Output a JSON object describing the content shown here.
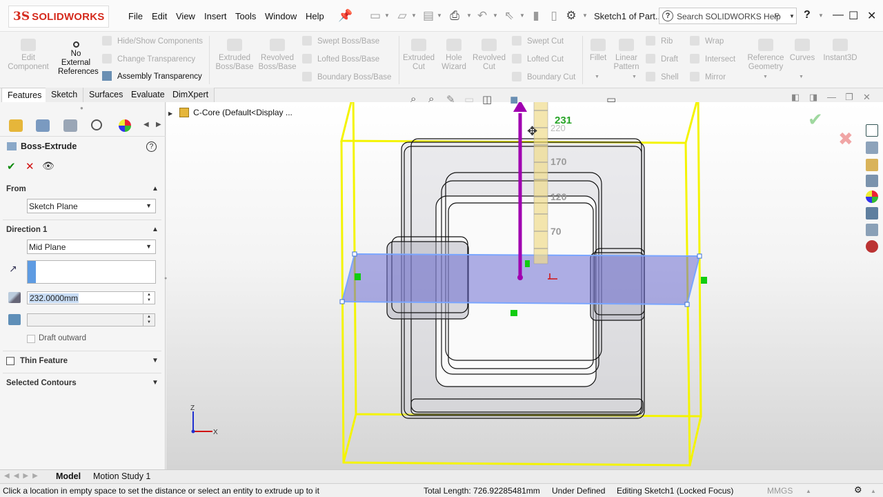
{
  "app": {
    "brand_ds": "3S",
    "brand_name": "SOLIDWORKS"
  },
  "menu": [
    "File",
    "Edit",
    "View",
    "Insert",
    "Tools",
    "Window",
    "Help"
  ],
  "document_title": "Sketch1 of Part...",
  "search": {
    "placeholder": "Search SOLIDWORKS Help"
  },
  "command_manager": {
    "edit_component": "Edit\nComponent",
    "no_external": [
      "No",
      "External",
      "References"
    ],
    "hide_show": "Hide/Show Components",
    "change_transparency": "Change Transparency",
    "assembly_transparency": "Assembly Transparency",
    "extruded_boss": [
      "Extruded",
      "Boss/Base"
    ],
    "revolved_boss": [
      "Revolved",
      "Boss/Base"
    ],
    "swept_boss": "Swept Boss/Base",
    "lofted_boss": "Lofted Boss/Base",
    "boundary_boss": "Boundary Boss/Base",
    "extruded_cut": [
      "Extruded",
      "Cut"
    ],
    "hole_wizard": [
      "Hole",
      "Wizard"
    ],
    "revolved_cut": [
      "Revolved",
      "Cut"
    ],
    "swept_cut": "Swept Cut",
    "lofted_cut": "Lofted Cut",
    "boundary_cut": "Boundary Cut",
    "fillet": "Fillet",
    "linear_pattern": [
      "Linear",
      "Pattern"
    ],
    "rib": "Rib",
    "draft": "Draft",
    "shell": "Shell",
    "wrap": "Wrap",
    "intersect": "Intersect",
    "mirror": "Mirror",
    "reference_geometry": [
      "Reference",
      "Geometry"
    ],
    "curves": "Curves",
    "instant3d": "Instant3D"
  },
  "command_tabs": [
    "Features",
    "Sketch",
    "Surfaces",
    "Evaluate",
    "DimXpert"
  ],
  "property_manager": {
    "title": "Boss-Extrude",
    "from_label": "From",
    "from_value": "Sketch Plane",
    "direction1_label": "Direction 1",
    "direction1_value": "Mid Plane",
    "depth_value": "232.0000mm",
    "draft_outward": "Draft outward",
    "thin_feature": "Thin Feature",
    "selected_contours": "Selected Contours"
  },
  "feature_tree": {
    "root": "C-Core  (Default<Display ..."
  },
  "ruler": {
    "ticks": [
      "270",
      "231",
      "220",
      "170",
      "120",
      "70"
    ]
  },
  "triad": {
    "z": "Z",
    "x": "X"
  },
  "bottom_tabs": [
    "Model",
    "Motion Study 1"
  ],
  "status": {
    "hint": "Click a location in empty space to set the distance or select an entity to extrude up to it",
    "total_length": "Total Length: 726.92285481mm",
    "defined": "Under Defined",
    "editing": "Editing Sketch1 (Locked Focus)",
    "units": "MMGS"
  },
  "colors": {
    "accent_blue": "#5e9be2",
    "preview_yellow": "#f7f700",
    "extrude_arrow": "#a000b0",
    "sketch_plane": "#9a9ad8"
  }
}
